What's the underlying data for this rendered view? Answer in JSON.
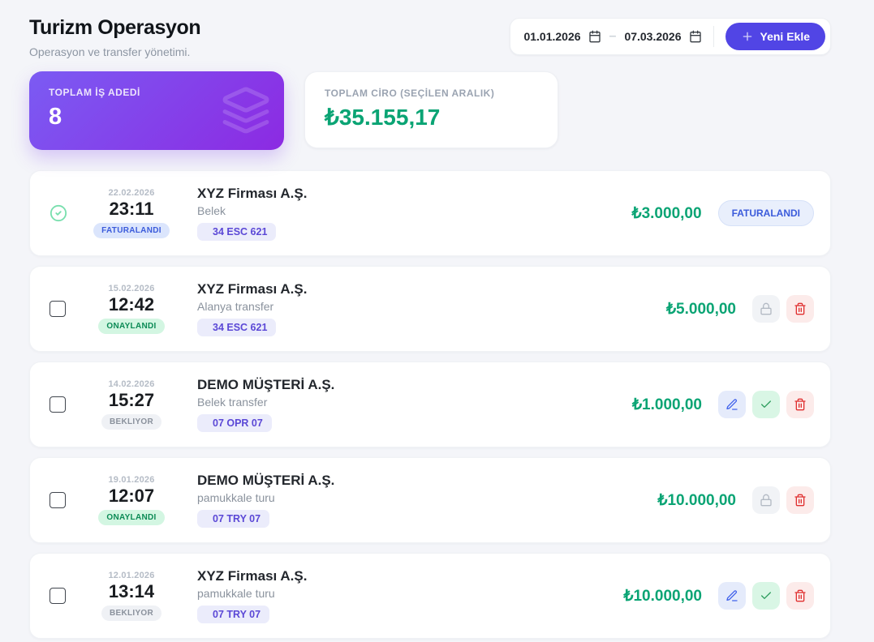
{
  "header": {
    "title": "Turizm Operasyon",
    "subtitle": "Operasyon ve transfer yönetimi.",
    "date_from": "01.01.2026",
    "date_to": "07.03.2026",
    "date_separator": "–",
    "add_button_label": "Yeni Ekle"
  },
  "stats": {
    "jobs": {
      "label": "TOPLAM İŞ ADEDİ",
      "value": "8",
      "icon": "layers-icon"
    },
    "revenue": {
      "label": "TOPLAM CİRO (SEÇİLEN ARALIK)",
      "value": "₺35.155,17"
    }
  },
  "colors": {
    "accent_purple": "#5145e5",
    "card_gradient_start": "#7b5bf3",
    "card_gradient_end": "#8c2ae2",
    "money_green": "#0aa474",
    "status_invoiced": "#3b5bdb",
    "status_approved": "#0b8a55",
    "status_pending": "#8a919c",
    "delete_red": "#e03131"
  },
  "rows": [
    {
      "date": "22.02.2026",
      "time": "23:11",
      "status": "FATURALANDI",
      "status_type": "invoiced",
      "company": "XYZ Firması A.Ş.",
      "description": "Belek",
      "plate": "34 ESC 621",
      "amount": "₺3.000,00",
      "selector": "check-circle",
      "right_badge": "FATURALANDI",
      "actions": []
    },
    {
      "date": "15.02.2026",
      "time": "12:42",
      "status": "ONAYLANDI",
      "status_type": "approved",
      "company": "XYZ Firması A.Ş.",
      "description": "Alanya transfer",
      "plate": "34 ESC 621",
      "amount": "₺5.000,00",
      "selector": "checkbox",
      "right_badge": null,
      "actions": [
        "lock",
        "delete"
      ]
    },
    {
      "date": "14.02.2026",
      "time": "15:27",
      "status": "BEKLIYOR",
      "status_type": "pending",
      "company": "DEMO MÜŞTERİ A.Ş.",
      "description": "Belek transfer",
      "plate": "07 OPR 07",
      "amount": "₺1.000,00",
      "selector": "checkbox",
      "right_badge": null,
      "actions": [
        "edit",
        "approve",
        "delete"
      ]
    },
    {
      "date": "19.01.2026",
      "time": "12:07",
      "status": "ONAYLANDI",
      "status_type": "approved",
      "company": "DEMO MÜŞTERİ A.Ş.",
      "description": "pamukkale turu",
      "plate": "07 TRY 07",
      "amount": "₺10.000,00",
      "selector": "checkbox",
      "right_badge": null,
      "actions": [
        "lock",
        "delete"
      ]
    },
    {
      "date": "12.01.2026",
      "time": "13:14",
      "status": "BEKLIYOR",
      "status_type": "pending",
      "company": "XYZ Firması A.Ş.",
      "description": "pamukkale turu",
      "plate": "07 TRY 07",
      "amount": "₺10.000,00",
      "selector": "checkbox",
      "right_badge": null,
      "actions": [
        "edit",
        "approve",
        "delete"
      ]
    }
  ]
}
